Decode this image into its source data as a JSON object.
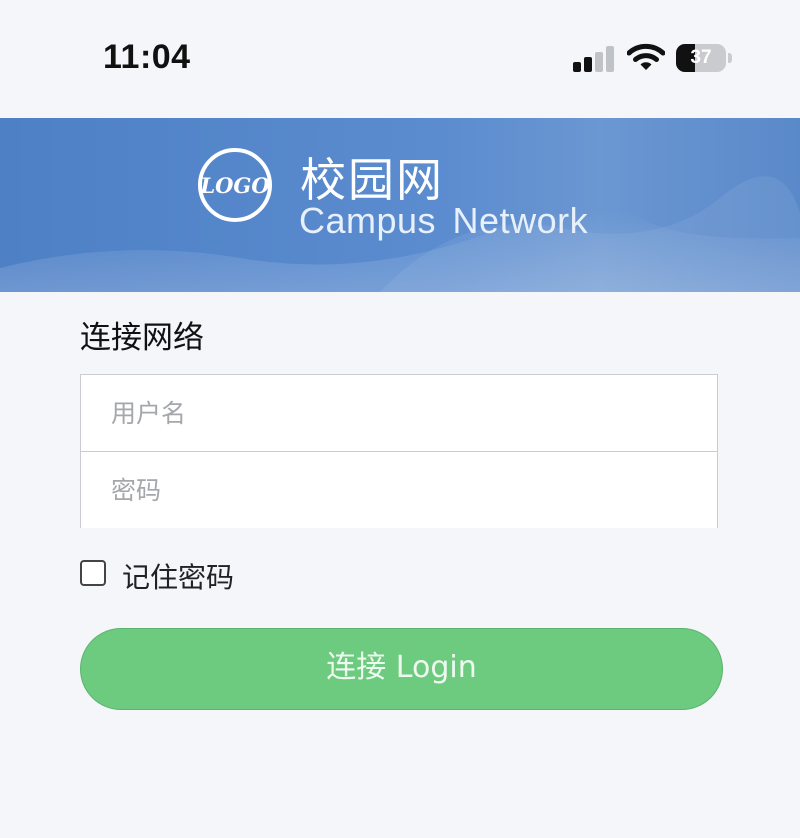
{
  "status_bar": {
    "time": "11:04",
    "battery_level": "37",
    "icons": [
      "cellular-signal-icon",
      "wifi-icon",
      "battery-icon"
    ]
  },
  "banner": {
    "logo_text": "LOGO",
    "title_cn": "校园网",
    "title_en": "Campus Network"
  },
  "form": {
    "section_title": "连接网络",
    "username": {
      "value": "",
      "placeholder": "用户名"
    },
    "password": {
      "value": "",
      "placeholder": "密码"
    },
    "remember_label": "记住密码",
    "remember_checked": false,
    "login_label": "连接 Login"
  },
  "colors": {
    "banner_blue": "#4e80c6",
    "button_green": "#6ccb7f",
    "page_background": "#f4f6f9"
  }
}
